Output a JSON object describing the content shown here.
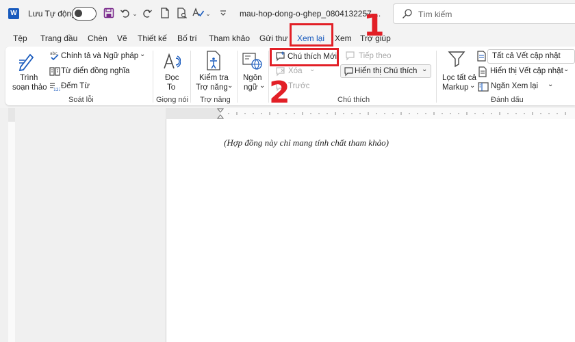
{
  "titlebar": {
    "autosave_label": "Lưu Tự động",
    "filename": "mau-hop-dong-o-ghep_0804132257....",
    "search_placeholder": "Tìm kiếm"
  },
  "tabs": [
    "Tệp",
    "Trang đầu",
    "Chèn",
    "Vẽ",
    "Thiết kế",
    "Bố trí",
    "Tham khảo",
    "Gửi thư",
    "Xem lại",
    "Xem",
    "Trợ giúp"
  ],
  "active_tab": "Xem lại",
  "ribbon": {
    "proofing": {
      "editor_line1": "Trình",
      "editor_line2": "soạn thảo",
      "spelling": "Chính tả và Ngữ pháp",
      "thesaurus": "Từ điển đồng nghĩa",
      "word_count": "Đếm Từ",
      "group_label": "Soát lỗi"
    },
    "speech": {
      "read_line1": "Đọc",
      "read_line2": "To",
      "group_label": "Giọng nói"
    },
    "accessibility": {
      "check_line1": "Kiểm tra",
      "check_line2": "Trợ năng",
      "group_label": "Trợ năng"
    },
    "language": {
      "line1": "Ngôn",
      "line2": "ngữ"
    },
    "comments": {
      "new_comment": "Chú thích Mới",
      "delete": "Xóa",
      "previous": "Trước",
      "next": "Tiếp theo",
      "show_comments": "Hiển thị Chú thích",
      "group_label": "Chú thích"
    },
    "tracking": {
      "filter_line1": "Lọc tất cả",
      "filter_line2": "Markup",
      "all_markup": "Tất cả Vết cập nhật",
      "show_markup": "Hiển thị Vết cập nhật",
      "reviewing_pane": "Ngăn Xem lại",
      "group_label": "Đánh dấu"
    }
  },
  "document": {
    "text": "(Hợp đồng này chỉ mang tính chất tham khảo)"
  },
  "annotations": {
    "step1": "1",
    "step2": "2"
  },
  "colors": {
    "accent": "#185abd",
    "highlight_red": "#e21f26"
  }
}
